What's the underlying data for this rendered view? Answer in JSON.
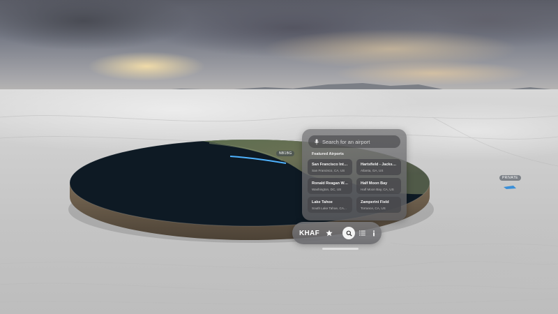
{
  "map": {
    "labels": [
      "NB1BG",
      "PRIVATE"
    ]
  },
  "search": {
    "placeholder": "Search for an airport"
  },
  "featured": {
    "title": "Featured Airports",
    "airports": [
      {
        "name": "San Francisco Inter...",
        "location": "San Francisco, CA, US"
      },
      {
        "name": "Hartsfield - Jackson...",
        "location": "Atlanta, GA, US"
      },
      {
        "name": "Ronald Reagan Was...",
        "location": "Washington, DC, US"
      },
      {
        "name": "Half Moon Bay",
        "location": "Half Moon Bay, CA, US"
      },
      {
        "name": "Lake Tahoe",
        "location": "South Lake Tahoe, CA..."
      },
      {
        "name": "Zamperini Field",
        "location": "Torrance, CA, US"
      }
    ]
  },
  "toolbar": {
    "airport_code": "KHAF",
    "buttons": [
      "star-icon",
      "search-icon",
      "list-icon",
      "info-icon"
    ],
    "active": "search-icon"
  },
  "colors": {
    "flight_path": "#4fb3ff",
    "panel": "#6e6e72",
    "active_button": "#f4f4f4"
  }
}
